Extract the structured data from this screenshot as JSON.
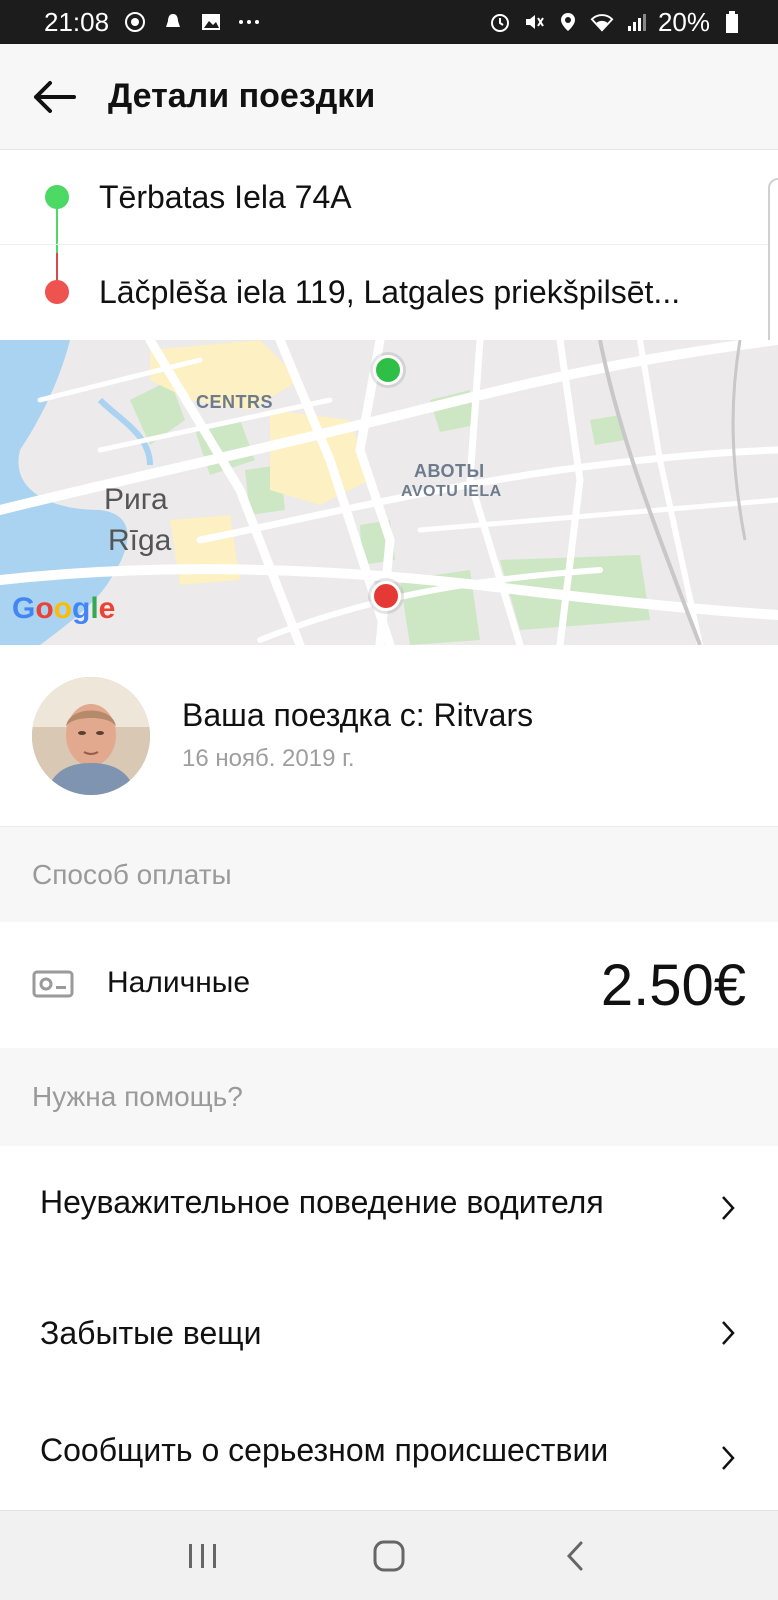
{
  "status_bar": {
    "time": "21:08",
    "battery": "20%",
    "left_icons": [
      "chrome-icon",
      "notification-icon",
      "gallery-icon",
      "more-icon"
    ],
    "right_icons": [
      "alarm-icon",
      "mute-icon",
      "location-icon",
      "wifi-icon",
      "signal-icon",
      "battery-icon"
    ]
  },
  "header": {
    "title": "Детали поездки",
    "back_icon": "arrow-left-icon"
  },
  "route": {
    "pickup": "Tērbatas Iela 74A",
    "dropoff": "Lāčplēša iela 119, Latgales priekšpilsēt..."
  },
  "map": {
    "labels": {
      "centrs": "CENTRS",
      "avoty": "АВОТЫ",
      "avotu_iela": "AVOTU IELA",
      "city_ru": "Рига",
      "city_lv": "Rīga"
    },
    "logo": "Google",
    "colors": {
      "water": "#a9d3f0",
      "park": "#cde7c4",
      "road": "#ffffff",
      "highlight": "#fdf0c2",
      "land": "#eceaea"
    }
  },
  "driver": {
    "title": "Ваша поездка с: Ritvars",
    "date": "16 нояб. 2019 г."
  },
  "payment": {
    "section_title": "Способ оплаты",
    "method": "Наличные",
    "amount": "2.50€"
  },
  "help": {
    "section_title": "Нужна помощь?",
    "items": [
      {
        "label": "Неуважительное поведение водителя"
      },
      {
        "label": "Забытые вещи"
      },
      {
        "label": "Сообщить о серьезном происшествии"
      }
    ]
  },
  "colors": {
    "pickup": "#4cd964",
    "dropoff": "#ef5350",
    "text_primary": "#111111",
    "text_secondary": "#9a9a9a"
  }
}
